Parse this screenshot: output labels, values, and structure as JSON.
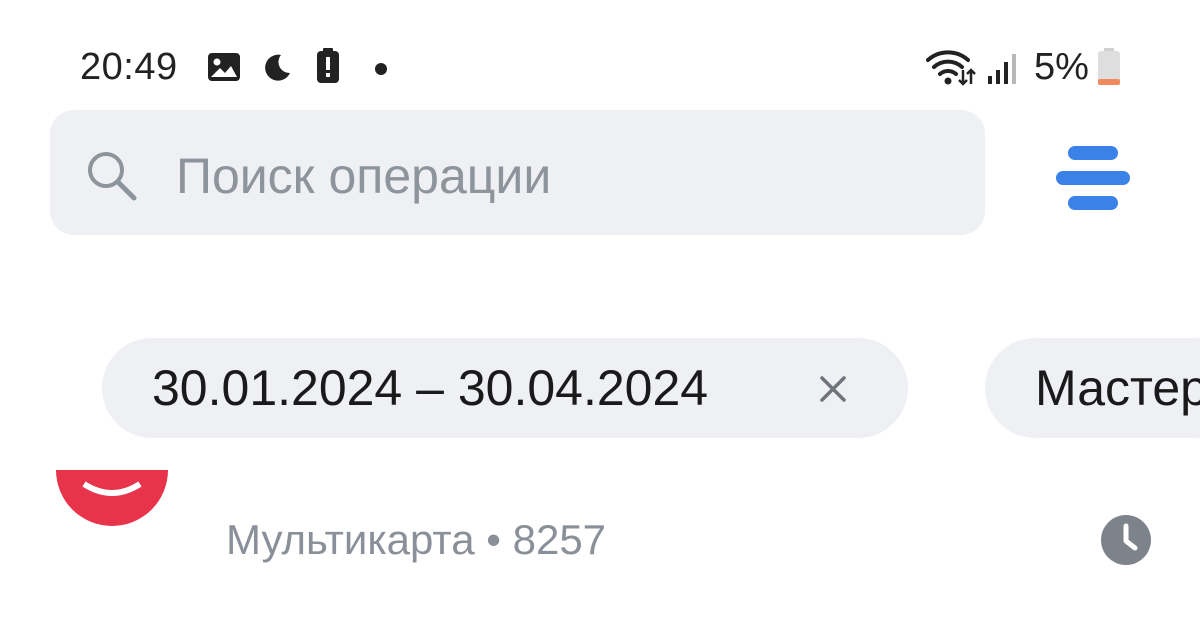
{
  "status_bar": {
    "time": "20:49",
    "left_icons": [
      "gallery-icon",
      "moon-icon",
      "battery-alert-icon",
      "notification-dot-icon"
    ],
    "right_icons": [
      "wifi-icon",
      "signal-icon",
      "battery-low-icon"
    ],
    "battery_percent": "5%"
  },
  "search": {
    "placeholder": "Поиск операции"
  },
  "filters": {
    "date_range": "30.01.2024 – 30.04.2024",
    "card_chip": "Мастер"
  },
  "operation": {
    "subtitle": "Мультикарта • 8257"
  },
  "colors": {
    "accent_blue": "#3b82e8",
    "chip_bg": "#eef0f4",
    "logo_red": "#e8344a",
    "muted_text": "#8a9099",
    "battery_low": "#f08a5d"
  }
}
